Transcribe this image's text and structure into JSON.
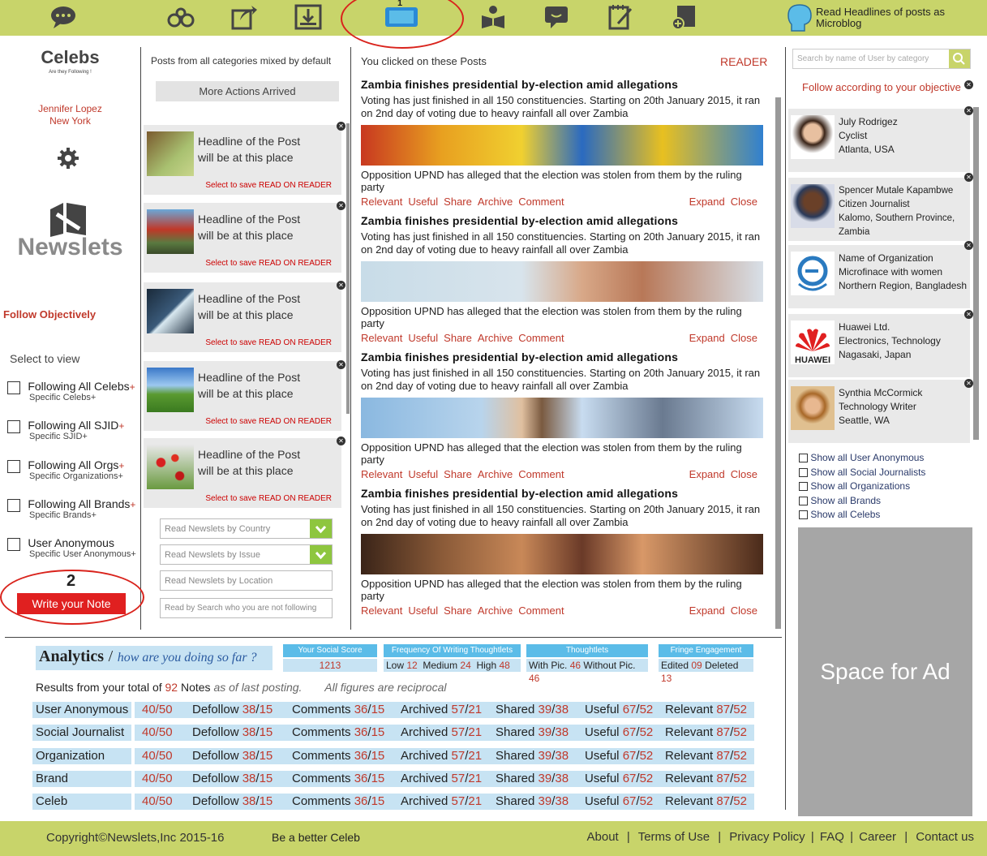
{
  "topbar": {
    "icons": [
      "chat-icon",
      "binoculars-icon",
      "share-icon",
      "download-icon",
      "tablet-reader-icon",
      "reading-person-icon",
      "message-icon",
      "notepad-icon",
      "add-document-icon"
    ],
    "annotation": "1",
    "tip": "Read Headlines of posts as Microblog"
  },
  "left": {
    "brand_title": "Celebs",
    "brand_sub": "Are they Following !",
    "user_name": "Jennifer Lopez",
    "user_city": "New York",
    "logo_text": "Newslets",
    "follow_label": "Follow Objectively",
    "select_label": "Select to view",
    "filters": [
      {
        "label": "Following All Celebs",
        "sub": "Specific Celebs"
      },
      {
        "label": "Following All SJID",
        "sub": "Specific SJID"
      },
      {
        "label": "Following All Orgs",
        "sub": "Specific Organizations"
      },
      {
        "label": "Following All Brands",
        "sub": "Specific Brands"
      },
      {
        "label": "User Anonymous",
        "sub": "Specific User Anonymous"
      }
    ],
    "plus": "+",
    "annotation": "2",
    "write_note": "Write your Note"
  },
  "posts_col": {
    "heading": "Posts from all categories mixed by default",
    "more_actions": "More Actions Arrived",
    "cards": [
      {
        "line1": "Headline of the Post",
        "line2": "will be at this place",
        "save": "Select to save READ ON READER"
      },
      {
        "line1": "Headline of the Post",
        "line2": "will be at this place",
        "save": "Select to save READ ON READER"
      },
      {
        "line1": "Headline of the Post",
        "line2": "will be at this place",
        "save": "Select to save READ ON READER"
      },
      {
        "line1": "Headline of the Post",
        "line2": "will be at this place",
        "save": "Select to save READ ON READER"
      },
      {
        "line1": "Headline of the Post",
        "line2": "will be at this place",
        "save": "Select to save READ ON READER"
      }
    ],
    "selects": [
      "Read Newslets by Country",
      "Read Newslets by Issue",
      "Read Newslets by Location",
      "Read by Search who you are not following"
    ]
  },
  "reader": {
    "heading": "You clicked on these Posts",
    "label": "READER",
    "items": [
      {
        "title": "Zambia finishes presidential by-election amid allegations",
        "body": "Voting has just finished in all 150 constituencies. Starting on 20th January 2015, it ran on 2nd day of voting due to heavy rainfall all over Zambia",
        "opp": "Opposition UPND has alleged that the election was stolen from them by the ruling party"
      },
      {
        "title": "Zambia finishes presidential by-election amid allegations",
        "body": "Voting has just finished in all 150 constituencies. Starting on 20th January 2015, it ran on 2nd day of voting due to heavy rainfall all over Zambia",
        "opp": "Opposition UPND has alleged that the election was stolen from them by the ruling party"
      },
      {
        "title": "Zambia finishes presidential by-election amid allegations",
        "body": "Voting has just finished in all 150 constituencies. Starting on 20th January 2015, it ran on 2nd day of voting due to heavy rainfall all over Zambia",
        "opp": "Opposition UPND has alleged that the election was stolen from them by the ruling party"
      },
      {
        "title": "Zambia finishes presidential by-election amid allegations",
        "body": "Voting has just finished in all 150 constituencies. Starting on 20th January 2015, it ran on 2nd day of voting due to heavy rainfall all over Zambia",
        "opp": "Opposition UPND has alleged that the election was stolen from them by the ruling party"
      }
    ],
    "actions": [
      "Relevant",
      "Useful",
      "Share",
      "Archive",
      "Comment"
    ],
    "expand": "Expand",
    "close": "Close"
  },
  "right": {
    "search_placeholder": "Search by name of User by category",
    "follow_heading": "Follow according to your objective",
    "cards": [
      {
        "l1": "July Rodrigez",
        "l2": "Cyclist",
        "l3": "Atlanta, USA"
      },
      {
        "l1": "Spencer Mutale Kapambwe",
        "l2": "Citizen Journalist",
        "l3": "Kalomo, Southern Province, Zambia"
      },
      {
        "l1": "Name of Organization",
        "l2": "Microfinace with women",
        "l3": "Northern Region, Bangladesh"
      },
      {
        "l1": "Huawei Ltd.",
        "l2": "Electronics, Technology",
        "l3": "Nagasaki, Japan"
      },
      {
        "l1": "Synthia McCormick",
        "l2": "Technology Writer",
        "l3": "Seattle, WA"
      }
    ],
    "huawei_logo": "HUAWEI",
    "show": [
      "Show all User Anonymous",
      "Show all Social Journalists",
      "Show all Organizations",
      "Show all Brands",
      "Show all Celebs"
    ],
    "ad": "Space for Ad"
  },
  "analytics": {
    "title": "Analytics",
    "slash": "/",
    "subtitle": "how are you doing so far ?",
    "stats": [
      {
        "head": "Your Social Score",
        "val": "1213"
      },
      {
        "head": "Frequency Of Writing Thoughtlets",
        "low_l": "Low",
        "low": "12",
        "med_l": "Medium",
        "med": "24",
        "high_l": "High",
        "high": "48"
      },
      {
        "head": "Thoughtlets",
        "wp_l": "With Pic.",
        "wp": "46",
        "wop_l": "Without Pic.",
        "wop": "46"
      },
      {
        "head": "Fringe Engagement",
        "ed_l": "Edited",
        "ed": "09",
        "del_l": "Deleted",
        "del": "13"
      }
    ],
    "results_pre": "Results from your total of",
    "results_num": "92",
    "results_post": "Notes",
    "results_tail": "as of last posting.",
    "reciprocal": "All figures are reciprocal",
    "rows": [
      {
        "name": "User Anonymous",
        "score": "40/50",
        "defollow_a": "38",
        "defollow_b": "15",
        "comments_a": "36",
        "comments_b": "15",
        "archived_a": "57",
        "archived_b": "21",
        "shared_a": "39",
        "shared_b": "38",
        "useful_a": "67",
        "useful_b": "52",
        "relevant_a": "87",
        "relevant_b": "52"
      },
      {
        "name": "Social Journalist",
        "score": "40/50",
        "defollow_a": "38",
        "defollow_b": "15",
        "comments_a": "36",
        "comments_b": "15",
        "archived_a": "57",
        "archived_b": "21",
        "shared_a": "39",
        "shared_b": "38",
        "useful_a": "67",
        "useful_b": "52",
        "relevant_a": "87",
        "relevant_b": "52"
      },
      {
        "name": "Organization",
        "score": "40/50",
        "defollow_a": "38",
        "defollow_b": "15",
        "comments_a": "36",
        "comments_b": "15",
        "archived_a": "57",
        "archived_b": "21",
        "shared_a": "39",
        "shared_b": "38",
        "useful_a": "67",
        "useful_b": "52",
        "relevant_a": "87",
        "relevant_b": "52"
      },
      {
        "name": "Brand",
        "score": "40/50",
        "defollow_a": "38",
        "defollow_b": "15",
        "comments_a": "36",
        "comments_b": "15",
        "archived_a": "57",
        "archived_b": "21",
        "shared_a": "39",
        "shared_b": "38",
        "useful_a": "67",
        "useful_b": "52",
        "relevant_a": "87",
        "relevant_b": "52"
      },
      {
        "name": "Celeb",
        "score": "40/50",
        "defollow_a": "38",
        "defollow_b": "15",
        "comments_a": "36",
        "comments_b": "15",
        "archived_a": "57",
        "archived_b": "21",
        "shared_a": "39",
        "shared_b": "38",
        "useful_a": "67",
        "useful_b": "52",
        "relevant_a": "87",
        "relevant_b": "52"
      }
    ],
    "labels": {
      "defollow": "Defollow",
      "comments": "Comments",
      "archived": "Archived",
      "shared": "Shared",
      "useful": "Useful",
      "relevant": "Relevant"
    },
    "slash_sep": "/"
  },
  "footer": {
    "copyright": "Copyright©Newslets,Inc 2015-16",
    "tagline": "Be a better Celeb",
    "links": [
      "About",
      "Terms of Use",
      "Privacy Policy",
      "FAQ",
      "Career",
      "Contact us"
    ],
    "sep": "|"
  },
  "colors": {
    "bar": "#c8d46a",
    "accent_red": "#c0392b",
    "table_blue": "#c7e3f3",
    "header_blue": "#5bbce8",
    "green": "#8ec63f"
  }
}
